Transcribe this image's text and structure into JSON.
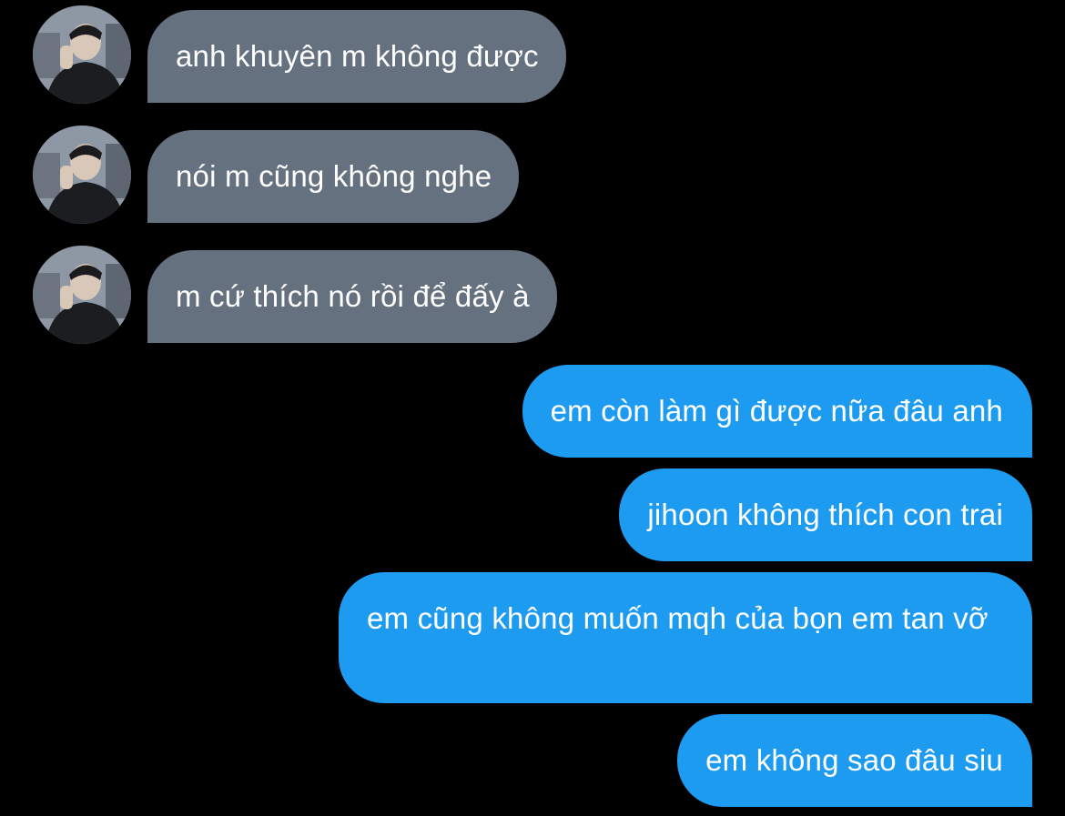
{
  "conversation": {
    "incoming": [
      {
        "text": "anh khuyên m không được",
        "avatar_icon": "user-avatar-photo"
      },
      {
        "text": "nói m cũng không nghe",
        "avatar_icon": "user-avatar-photo"
      },
      {
        "text": "m cứ thích nó rồi để đấy à",
        "avatar_icon": "user-avatar-photo"
      }
    ],
    "outgoing": [
      {
        "text": "em còn làm gì được nữa đâu anh"
      },
      {
        "text": "jihoon không thích con trai"
      },
      {
        "text": "em cũng không muốn mqh của bọn em tan vỡ"
      },
      {
        "text": "em không sao đâu siu"
      }
    ]
  },
  "colors": {
    "background": "#000000",
    "incoming_bubble": "#66717f",
    "outgoing_bubble": "#1d9bf0",
    "text": "#ffffff"
  }
}
